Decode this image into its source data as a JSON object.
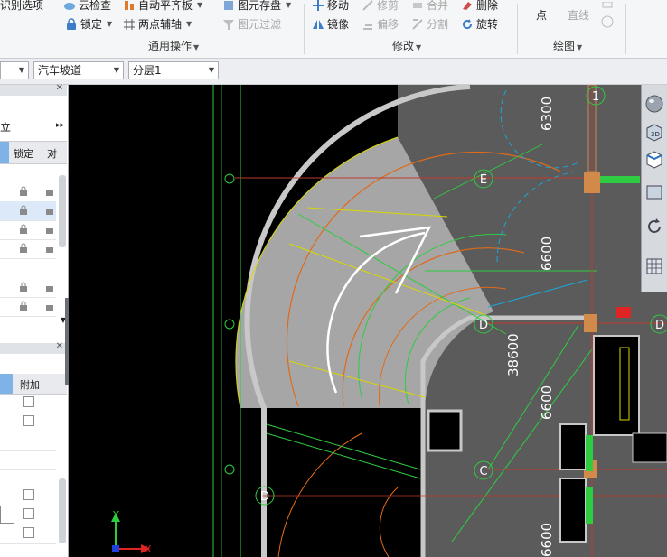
{
  "ribbon": {
    "left_item": "识别选项",
    "common_ops": {
      "title": "通用操作",
      "items": [
        {
          "label": "云检查",
          "disabled": false
        },
        {
          "label": "自动平齐板",
          "disabled": false
        },
        {
          "label": "图元存盘",
          "disabled": false
        },
        {
          "label": "锁定",
          "disabled": false
        },
        {
          "label": "两点辅轴",
          "disabled": false
        },
        {
          "label": "图元过滤",
          "disabled": true
        }
      ]
    },
    "modify": {
      "title": "修改",
      "items": [
        {
          "label": "移动",
          "disabled": false
        },
        {
          "label": "修剪",
          "disabled": true
        },
        {
          "label": "合并",
          "disabled": true
        },
        {
          "label": "删除",
          "disabled": false
        },
        {
          "label": "镜像",
          "disabled": false
        },
        {
          "label": "偏移",
          "disabled": true
        },
        {
          "label": "分割",
          "disabled": true
        },
        {
          "label": "旋转",
          "disabled": false
        }
      ]
    },
    "draw": {
      "title": "绘图",
      "items": [
        {
          "label": "点",
          "disabled": false
        },
        {
          "label": "直线",
          "disabled": true
        }
      ]
    }
  },
  "selectors": {
    "element_type": "汽车坡道",
    "layer": "分层1"
  },
  "left_panel": {
    "top_header_fragment": "立",
    "columns": [
      "锁定",
      "对"
    ],
    "bottom_columns": [
      "附加"
    ]
  },
  "canvas": {
    "axis_labels": [
      "1",
      "E",
      "D",
      "D",
      "C",
      "D"
    ],
    "dimensions": [
      "6300",
      "6600",
      "38600",
      "6600",
      "6600"
    ],
    "ucs": {
      "x": "X",
      "y": "Y"
    },
    "colors": {
      "background": "#000000",
      "ramp_fill": "#a6a6a6",
      "floor_fill": "#5b5b5b",
      "wall": "#c8c8c8",
      "axis_green": "#2ecc40",
      "orange": "#e06a1a",
      "yellow": "#d8d800",
      "cyan": "#1aa6d6"
    }
  },
  "view_tools": [
    "sphere-view-icon",
    "3d-view-icon",
    "top-view-icon",
    "front-view-icon",
    "rotate-icon",
    "grid-view-icon"
  ]
}
